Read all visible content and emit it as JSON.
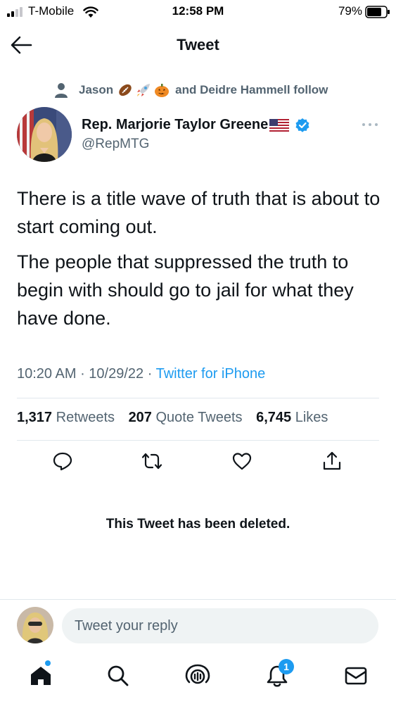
{
  "status_bar": {
    "carrier": "T-Mobile",
    "time": "12:58 PM",
    "battery_percent": "79%"
  },
  "nav": {
    "title": "Tweet"
  },
  "social_context": {
    "name": "Jason",
    "emojis": [
      "football",
      "rocket",
      "jack-o-lantern"
    ],
    "rest": "and Deidre Hammell follow"
  },
  "author": {
    "name": "Rep. Marjorie Taylor Greene",
    "handle": "@RepMTG",
    "verified": true
  },
  "tweet": {
    "paragraphs": [
      "There is a title wave of truth that is about to start coming out.",
      "The people that suppressed the truth to begin with should go to jail for what they have done."
    ],
    "time": "10:20 AM",
    "date": "10/29/22",
    "source": "Twitter for iPhone"
  },
  "stats": {
    "retweets_count": "1,317",
    "retweets_label": "Retweets",
    "quotes_count": "207",
    "quotes_label": "Quote Tweets",
    "likes_count": "6,745",
    "likes_label": "Likes"
  },
  "deleted_notice": "This Tweet has been deleted.",
  "reply": {
    "placeholder": "Tweet your reply"
  },
  "tabbar": {
    "notifications_badge": "1"
  },
  "colors": {
    "accent": "#1d9bf0",
    "secondary_text": "#536471",
    "divider": "#e1e8ed"
  }
}
